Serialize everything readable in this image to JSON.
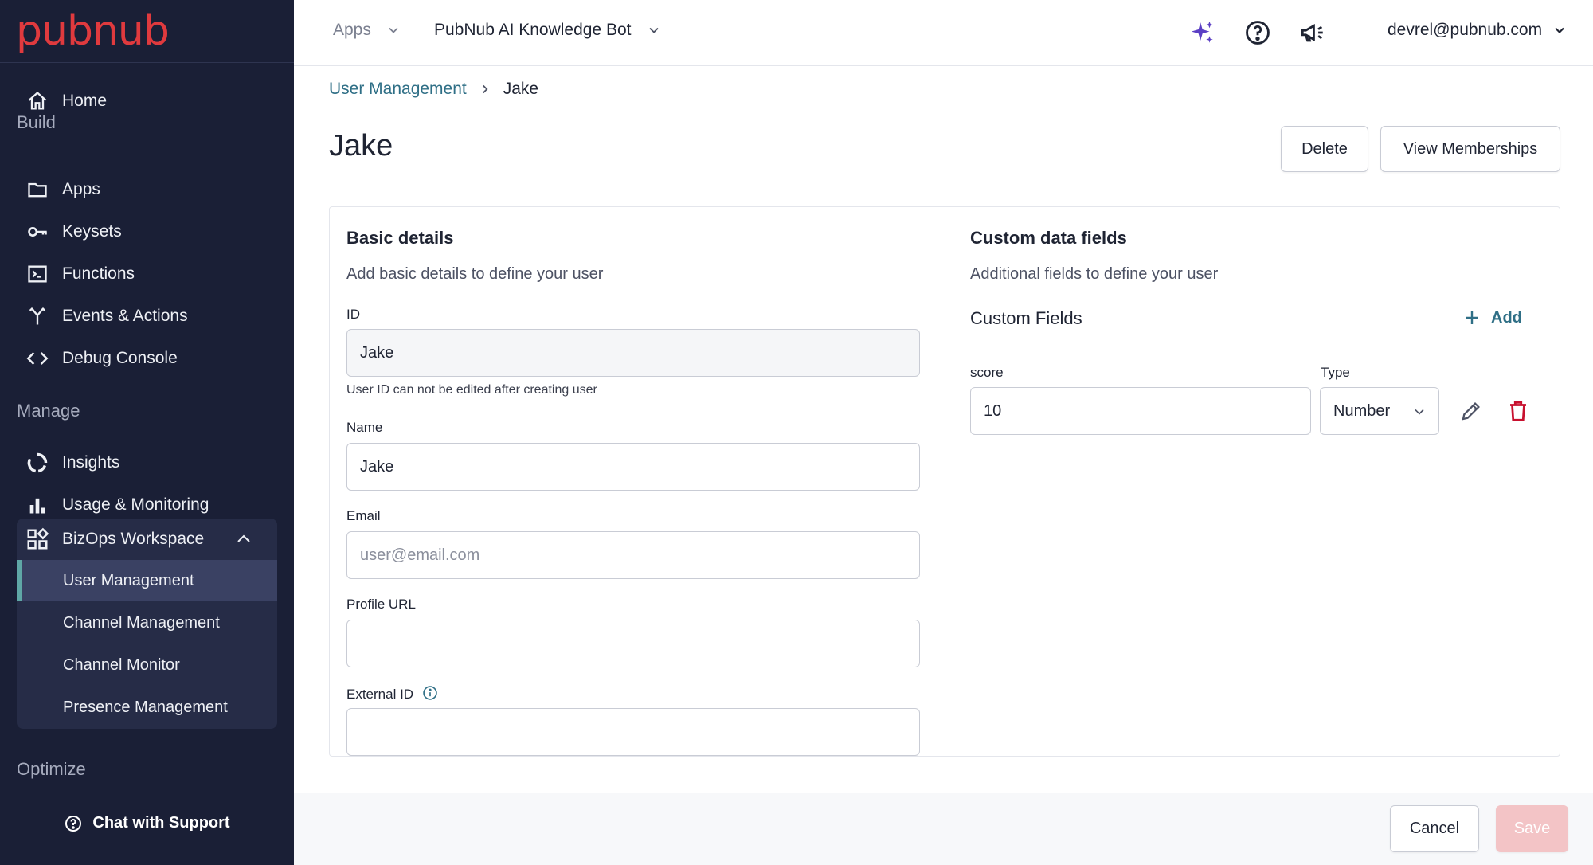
{
  "sidebar": {
    "logo": "pubnub",
    "home": "Home",
    "build_label": "Build",
    "build_items": [
      "Apps",
      "Keysets",
      "Functions",
      "Events & Actions",
      "Debug Console"
    ],
    "manage_label": "Manage",
    "manage_items": [
      "Insights",
      "Usage & Monitoring"
    ],
    "bizops": {
      "label": "BizOps Workspace",
      "items": [
        "User Management",
        "Channel Management",
        "Channel Monitor",
        "Presence Management"
      ],
      "active": "User Management"
    },
    "optimize_label": "Optimize",
    "support": "Chat with Support"
  },
  "topbar": {
    "apps": "Apps",
    "app_name": "PubNub AI Knowledge Bot",
    "user": "devrel@pubnub.com",
    "icons": [
      "ai-sparkle-icon",
      "help-icon",
      "announcement-icon"
    ]
  },
  "breadcrumb": {
    "parent": "User Management",
    "current": "Jake"
  },
  "page": {
    "title": "Jake",
    "delete_label": "Delete",
    "memberships_label": "View Memberships"
  },
  "basic": {
    "title": "Basic details",
    "subtitle": "Add basic details to define your user",
    "id_label": "ID",
    "id_value": "Jake",
    "id_help": "User ID can not be edited after creating user",
    "name_label": "Name",
    "name_value": "Jake",
    "email_label": "Email",
    "email_placeholder": "user@email.com",
    "profile_label": "Profile URL",
    "profile_value": "",
    "external_label": "External ID",
    "external_value": ""
  },
  "custom": {
    "title": "Custom data fields",
    "subtitle": "Additional fields to define your user",
    "fields_title": "Custom Fields",
    "add_label": "Add",
    "field": {
      "key": "score",
      "value": "10",
      "type_label": "Type",
      "type_value": "Number"
    }
  },
  "footer": {
    "cancel": "Cancel",
    "save": "Save"
  },
  "colors": {
    "sidebar_bg": "#1a1f36",
    "brand_red": "#e03a3e",
    "link_teal": "#2f6f86",
    "delete_red": "#c8102e",
    "save_disabled": "#f3c4c6",
    "sparkle_purple": "#5b3fc4"
  }
}
